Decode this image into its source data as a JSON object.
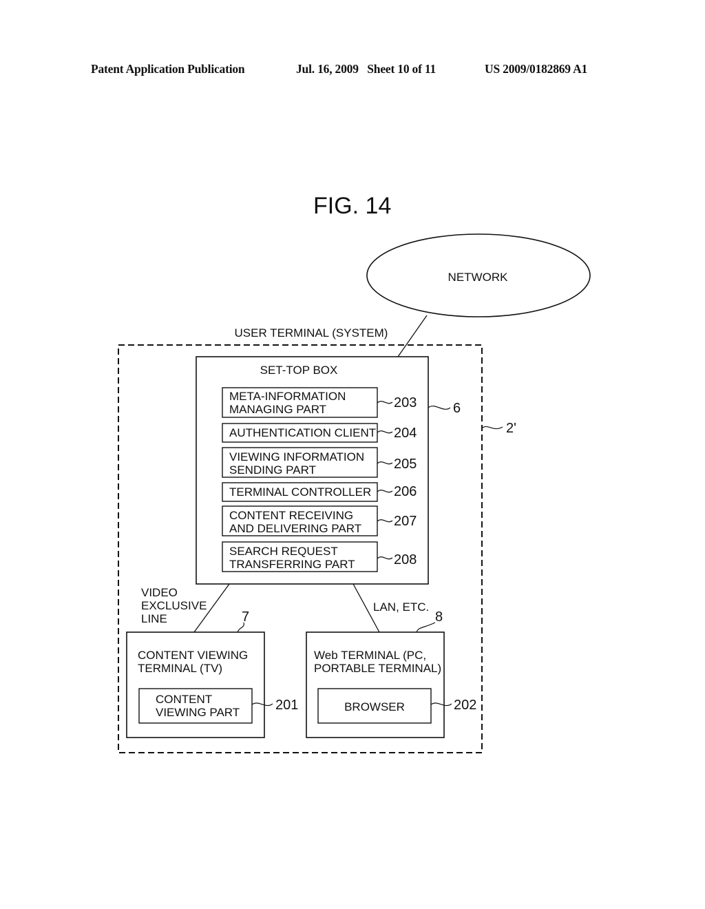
{
  "header": {
    "publication": "Patent Application Publication",
    "date_sheet": "Jul. 16, 2009   Sheet 10 of 11",
    "number": "US 2009/0182869 A1"
  },
  "figure": {
    "title": "FIG. 14",
    "network": "NETWORK",
    "user_terminal": {
      "label": "USER TERMINAL (SYSTEM)",
      "ref": "2'"
    },
    "set_top_box": {
      "label": "SET-TOP BOX",
      "ref": "6",
      "parts": [
        {
          "lines": [
            "META-INFORMATION",
            "MANAGING PART"
          ],
          "ref": "203"
        },
        {
          "lines": [
            "AUTHENTICATION CLIENT"
          ],
          "ref": "204"
        },
        {
          "lines": [
            "VIEWING INFORMATION",
            "SENDING PART"
          ],
          "ref": "205"
        },
        {
          "lines": [
            "TERMINAL CONTROLLER"
          ],
          "ref": "206"
        },
        {
          "lines": [
            "CONTENT RECEIVING",
            "AND DELIVERING PART"
          ],
          "ref": "207"
        },
        {
          "lines": [
            "SEARCH REQUEST",
            "TRANSFERRING PART"
          ],
          "ref": "208"
        }
      ]
    },
    "links": {
      "video_line": [
        "VIDEO",
        "EXCLUSIVE",
        "LINE"
      ],
      "lan": "LAN, ETC."
    },
    "content_viewing_terminal": {
      "lines": [
        "CONTENT VIEWING",
        "TERMINAL (TV)"
      ],
      "ref": "7",
      "part": {
        "lines": [
          "CONTENT",
          "VIEWING PART"
        ],
        "ref": "201"
      }
    },
    "web_terminal": {
      "lines": [
        "Web TERMINAL (PC,",
        "PORTABLE TERMINAL)"
      ],
      "ref": "8",
      "part": {
        "lines": [
          "BROWSER"
        ],
        "ref": "202"
      }
    }
  }
}
